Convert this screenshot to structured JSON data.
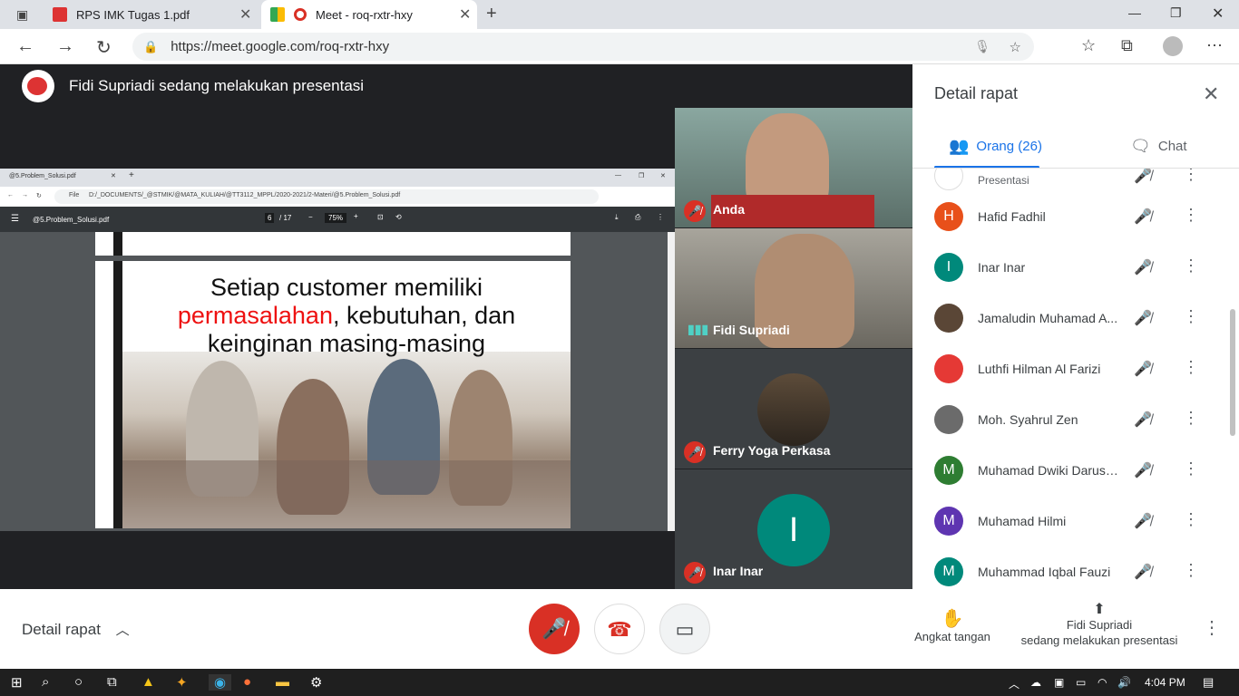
{
  "browser": {
    "tabs": [
      {
        "title": "RPS IMK Tugas 1.pdf",
        "icon": "pdf-icon"
      },
      {
        "title": "Meet - roq-rxtr-hxy",
        "icon": "meet-icon"
      }
    ],
    "url": "https://meet.google.com/roq-rxtr-hxy"
  },
  "meet": {
    "presenter_banner": "Fidi Supriadi sedang melakukan presentasi",
    "shared_screen": {
      "tab_title": "@5.Problem_Solusi.pdf",
      "address": "D:/_DOCUMENTS/_@STMIK/@MATA_KULIAH/@TT3112_MPPL/2020-2021/2-Materi/@5.Problem_Solusi.pdf",
      "file_label": "File",
      "doc_name": "@5.Problem_Solusi.pdf",
      "page_current": "6",
      "page_total": "/ 17",
      "zoom": "75%",
      "slide_line1": "Setiap customer memiliki",
      "slide_red": "permasalahan",
      "slide_line2_rest": ", kebutuhan, dan",
      "slide_line3": "keinginan masing-masing"
    },
    "tiles": [
      {
        "name": "Anda",
        "muted": true
      },
      {
        "name": "Fidi Supriadi",
        "muted": false
      },
      {
        "name": "Ferry Yoga Perkasa",
        "muted": true
      },
      {
        "name": "Inar Inar",
        "muted": true,
        "initial": "I",
        "color": "#00897b"
      }
    ]
  },
  "panel": {
    "title": "Detail rapat",
    "tab_people": "Orang (26)",
    "tab_chat": "Chat",
    "partial_row": "Presentasi",
    "people": [
      {
        "name": "Hafid Fadhil",
        "initial": "H",
        "color": "#e8501a"
      },
      {
        "name": "Inar Inar",
        "initial": "I",
        "color": "#00897b"
      },
      {
        "name": "Jamaludin Muhamad A...",
        "initial": "",
        "color": "#5a4636"
      },
      {
        "name": "Luthfi Hilman Al Farizi",
        "initial": "",
        "color": "#e53935"
      },
      {
        "name": "Moh. Syahrul Zen",
        "initial": "",
        "color": "#6b6b6b"
      },
      {
        "name": "Muhamad Dwiki Darusa...",
        "initial": "M",
        "color": "#2e7d32"
      },
      {
        "name": "Muhamad Hilmi",
        "initial": "M",
        "color": "#5e35b1"
      },
      {
        "name": "Muhammad Iqbal Fauzi",
        "initial": "M",
        "color": "#00897b"
      }
    ]
  },
  "bottom": {
    "detail_label": "Detail rapat",
    "raise_hand": "Angkat tangan",
    "presenting_line1": "Fidi Supriadi",
    "presenting_line2": "sedang melakukan presentasi"
  },
  "taskbar": {
    "time": "4:04 PM"
  }
}
